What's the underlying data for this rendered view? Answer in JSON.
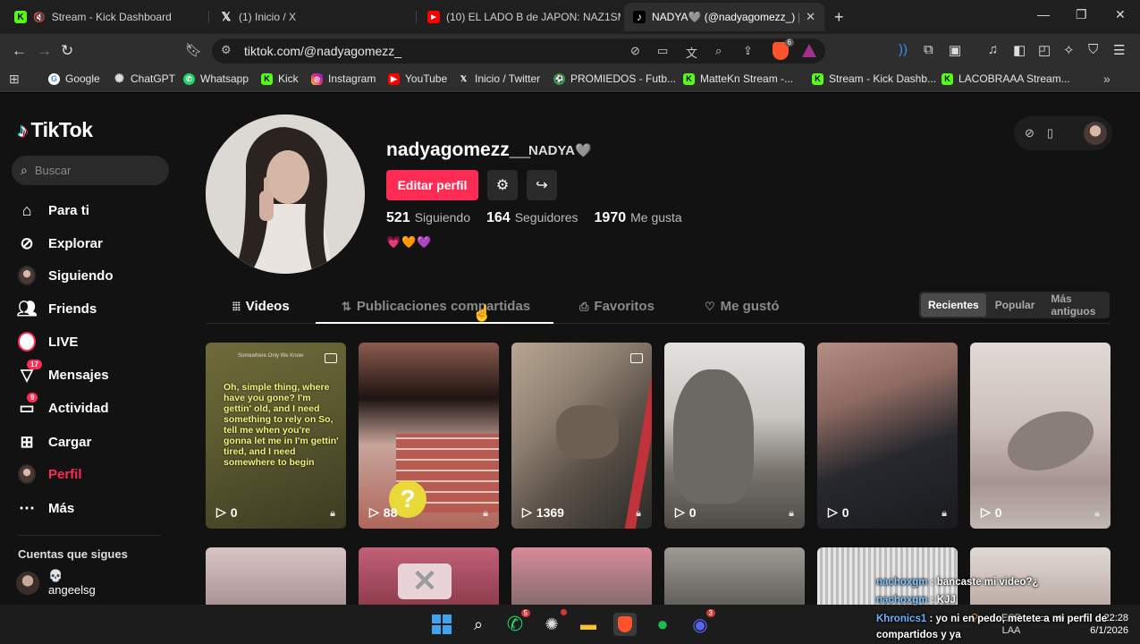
{
  "browser": {
    "tabs": [
      {
        "title": "Stream - Kick Dashboard",
        "favicon": "kick-icon"
      },
      {
        "title": "(1) Inicio / X",
        "favicon": "x-icon"
      },
      {
        "title": "(10) EL LADO B de JAPON: NAZ1SMO",
        "favicon": "youtube-icon"
      },
      {
        "title": "NADYA🩶 (@nadyagomezz_) |",
        "favicon": "tiktok-icon",
        "active": true
      }
    ],
    "url": "tiktok.com/@nadyagomezz_",
    "shield_count": "6",
    "bookmarks": [
      {
        "label": "Google"
      },
      {
        "label": "ChatGPT"
      },
      {
        "label": "Whatsapp"
      },
      {
        "label": "Kick"
      },
      {
        "label": "Instagram"
      },
      {
        "label": "YouTube"
      },
      {
        "label": "Inicio / Twitter"
      },
      {
        "label": "PROMIEDOS - Futb..."
      },
      {
        "label": "MatteKn Stream -..."
      },
      {
        "label": "Stream - Kick Dashb..."
      },
      {
        "label": "LACOBRAAA Stream..."
      }
    ]
  },
  "tiktok": {
    "logo": "TikTok",
    "search_placeholder": "Buscar",
    "nav": [
      {
        "label": "Para ti",
        "icon": "home-icon"
      },
      {
        "label": "Explorar",
        "icon": "compass-icon"
      },
      {
        "label": "Siguiendo",
        "icon": "avatar-icon"
      },
      {
        "label": "Friends",
        "icon": "friends-icon"
      },
      {
        "label": "LIVE",
        "icon": "live-icon"
      },
      {
        "label": "Mensajes",
        "icon": "send-icon",
        "badge": "17"
      },
      {
        "label": "Actividad",
        "icon": "message-icon",
        "badge": "9"
      },
      {
        "label": "Cargar",
        "icon": "upload-icon"
      },
      {
        "label": "Perfil",
        "icon": "avatar-icon",
        "active": true
      },
      {
        "label": "Más",
        "icon": "more-icon"
      }
    ],
    "following_title": "Cuentas que sigues",
    "following": [
      {
        "line1": "💀",
        "line2": "angeelsg"
      }
    ],
    "profile": {
      "username": "nadyagomezz__",
      "nickname": "NADYA🩶",
      "edit_label": "Editar perfil",
      "stats": [
        {
          "value": "521",
          "label": "Siguiendo"
        },
        {
          "value": "164",
          "label": "Seguidores"
        },
        {
          "value": "1970",
          "label": "Me gusta"
        }
      ],
      "bio": "💗🧡💜"
    },
    "tabs": [
      {
        "label": "Videos",
        "icon": "grid-icon"
      },
      {
        "label": "Publicaciones compartidas",
        "icon": "repost-icon",
        "active": true
      },
      {
        "label": "Favoritos",
        "icon": "bookmark-icon"
      },
      {
        "label": "Me gustó",
        "icon": "heart-icon"
      }
    ],
    "sort": [
      {
        "label": "Recientes",
        "active": true
      },
      {
        "label": "Popular"
      },
      {
        "label": "Más antiguos"
      }
    ],
    "videos": [
      {
        "views": "0",
        "multi": true
      },
      {
        "views": "88"
      },
      {
        "views": "1369",
        "multi": true
      },
      {
        "views": "0"
      },
      {
        "views": "0"
      },
      {
        "views": "0"
      }
    ],
    "meme": {
      "header": "Somewhere Only We Know",
      "lines": "Oh, simple thing, where have you gone? I'm gettin' old, and I need something to rely on So, tell me when you're gonna let me in I'm gettin' tired, and I need somewhere to begin"
    }
  },
  "taskbar": {
    "whatsapp_badge": "5",
    "discord_badge": "3",
    "lang_top": "ESP",
    "lang_bottom": "LAA",
    "time": "22:28",
    "date": "6/1/2026"
  },
  "chat": [
    {
      "user": "nachoxgm",
      "text": ": bancaste mi video?¿"
    },
    {
      "user": "nachoxgm",
      "text": ": KJJ"
    },
    {
      "user": "Khronics1",
      "text": ": yo ni en pedo, metete a mi perfil de"
    },
    {
      "user": "",
      "text": "compartidos y ya"
    }
  ]
}
